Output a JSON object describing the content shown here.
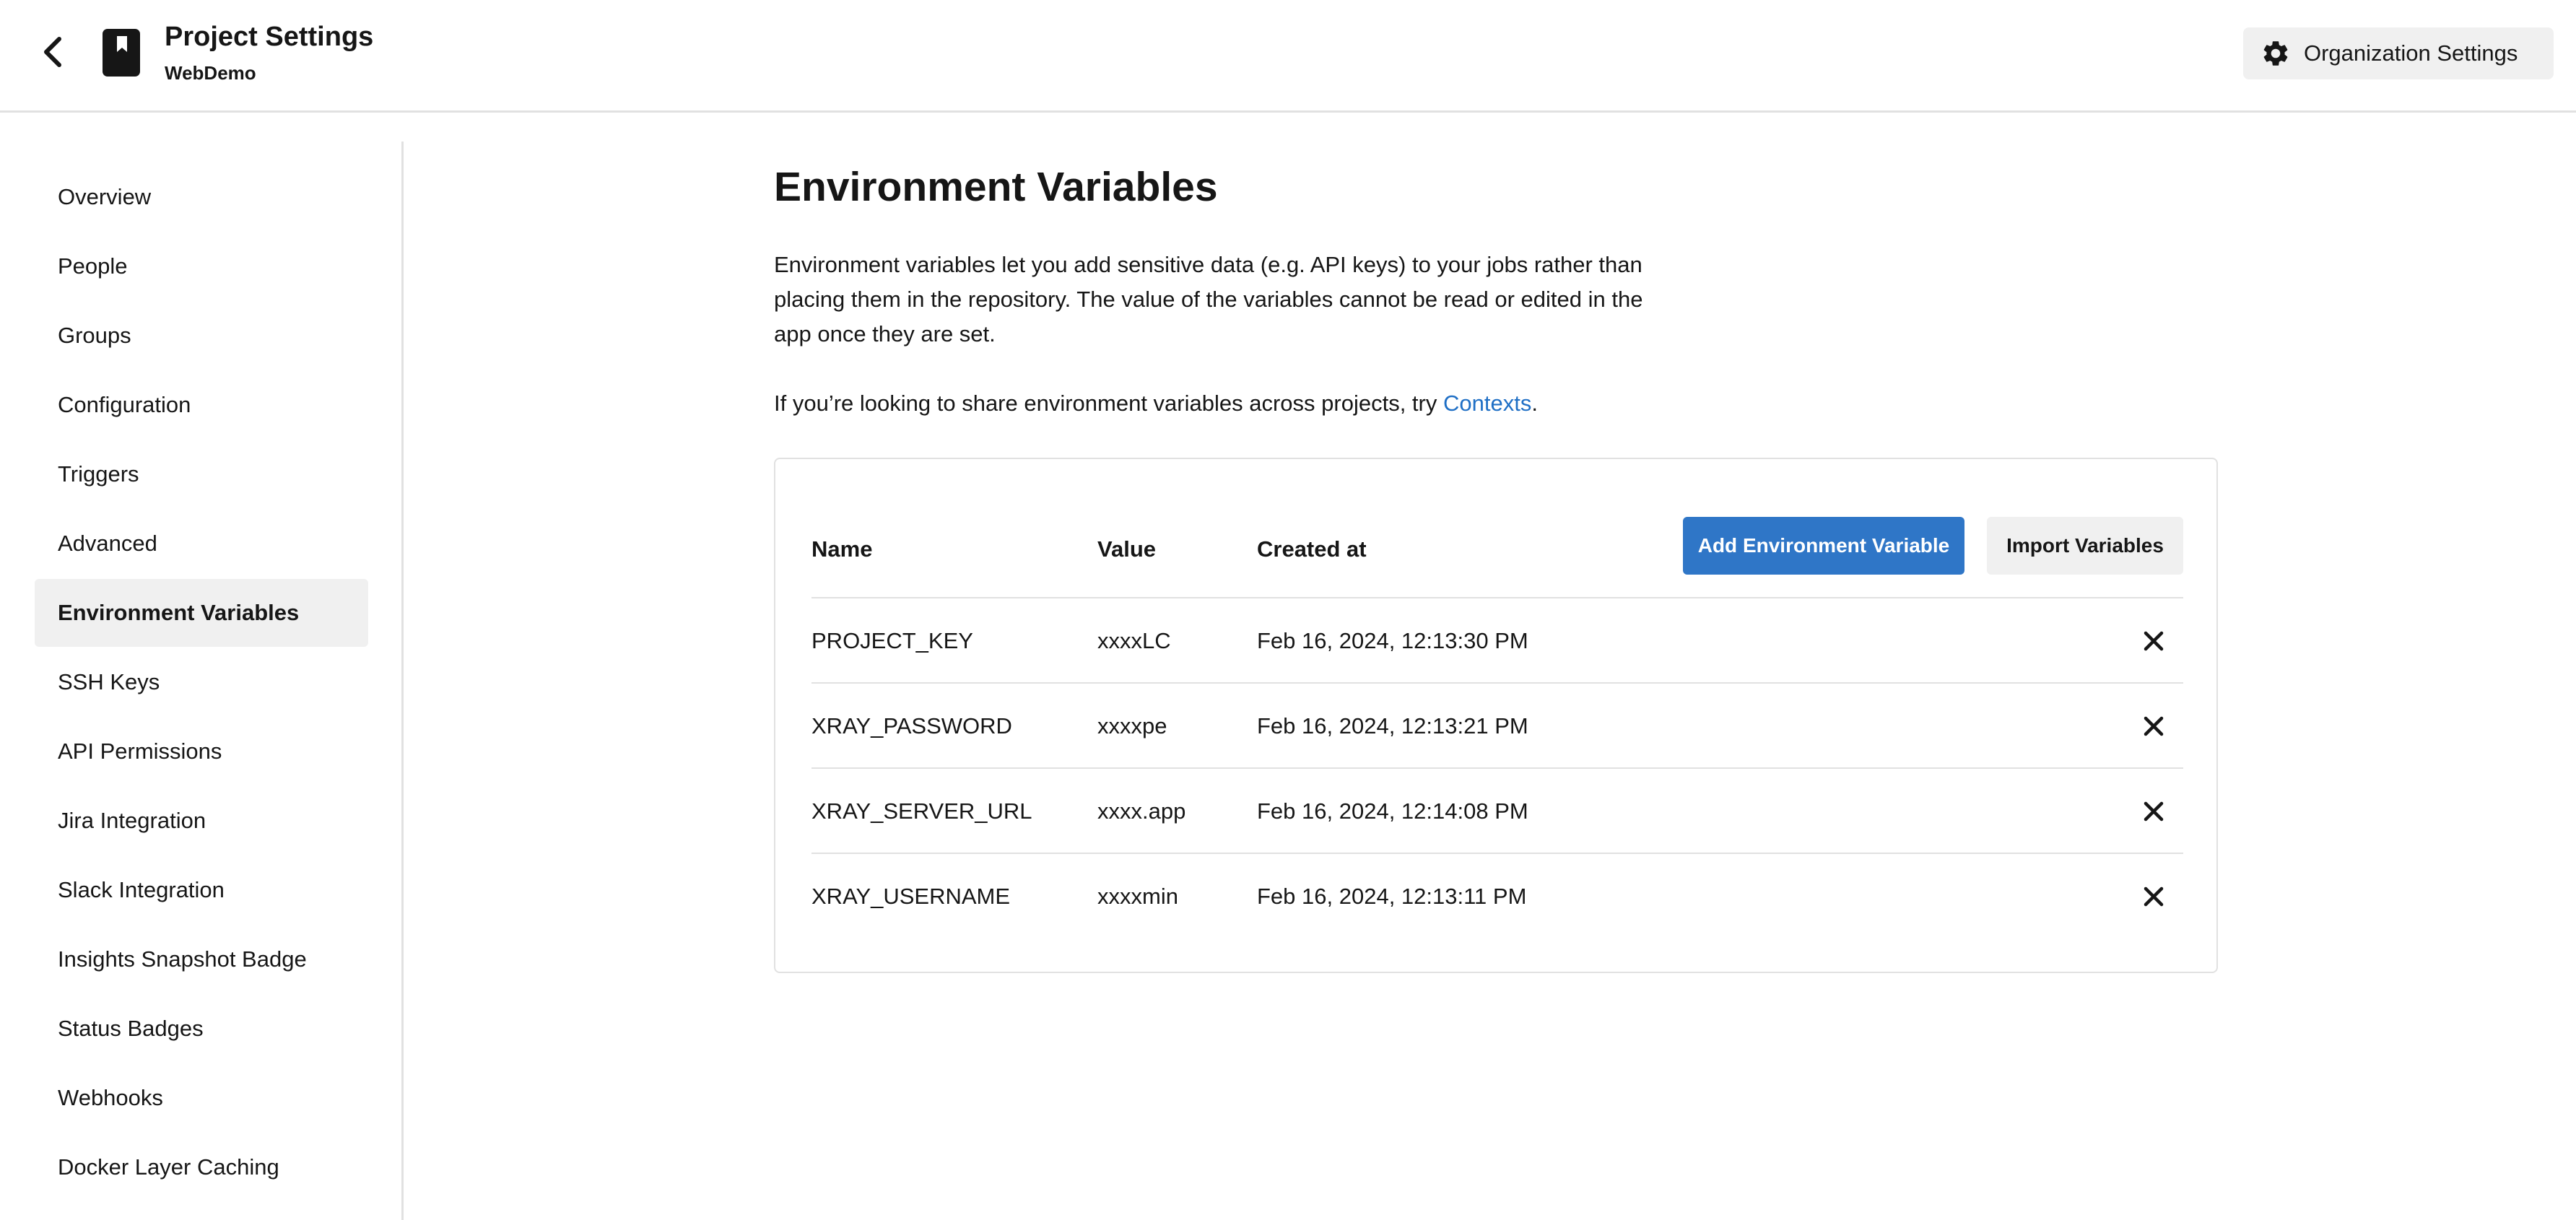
{
  "header": {
    "title": "Project Settings",
    "project_name": "WebDemo",
    "org_settings_label": "Organization Settings",
    "icons": {
      "back": "chevron-left-icon",
      "project": "bookmark-icon",
      "org": "gear-icon"
    }
  },
  "sidebar": {
    "items": [
      {
        "label": "Overview",
        "active": false
      },
      {
        "label": "People",
        "active": false
      },
      {
        "label": "Groups",
        "active": false
      },
      {
        "label": "Configuration",
        "active": false
      },
      {
        "label": "Triggers",
        "active": false
      },
      {
        "label": "Advanced",
        "active": false
      },
      {
        "label": "Environment Variables",
        "active": true
      },
      {
        "label": "SSH Keys",
        "active": false
      },
      {
        "label": "API Permissions",
        "active": false
      },
      {
        "label": "Jira Integration",
        "active": false
      },
      {
        "label": "Slack Integration",
        "active": false
      },
      {
        "label": "Insights Snapshot Badge",
        "active": false
      },
      {
        "label": "Status Badges",
        "active": false
      },
      {
        "label": "Webhooks",
        "active": false
      },
      {
        "label": "Docker Layer Caching",
        "active": false
      }
    ]
  },
  "main": {
    "title": "Environment Variables",
    "description": "Environment variables let you add sensitive data (e.g. API keys) to your jobs rather than placing them in the repository. The value of the variables cannot be read or edited in the app once they are set.",
    "share_prefix": "If you’re looking to share environment variables across projects, try ",
    "share_link": "Contexts",
    "share_suffix": ".",
    "table": {
      "columns": [
        "Name",
        "Value",
        "Created at"
      ],
      "add_button": "Add Environment Variable",
      "import_button": "Import Variables",
      "rows": [
        {
          "name": "PROJECT_KEY",
          "value": "xxxxLC",
          "created_at": "Feb 16, 2024, 12:13:30 PM"
        },
        {
          "name": "XRAY_PASSWORD",
          "value": "xxxxpe",
          "created_at": "Feb 16, 2024, 12:13:21 PM"
        },
        {
          "name": "XRAY_SERVER_URL",
          "value": "xxxx.app",
          "created_at": "Feb 16, 2024, 12:14:08 PM"
        },
        {
          "name": "XRAY_USERNAME",
          "value": "xxxxmin",
          "created_at": "Feb 16, 2024, 12:13:11 PM"
        }
      ]
    }
  },
  "colors": {
    "accent": "#2f76c7",
    "link": "#1f6fc5",
    "active_bg": "#f0f0f0",
    "border": "#e1e1e1",
    "text": "#161616"
  }
}
